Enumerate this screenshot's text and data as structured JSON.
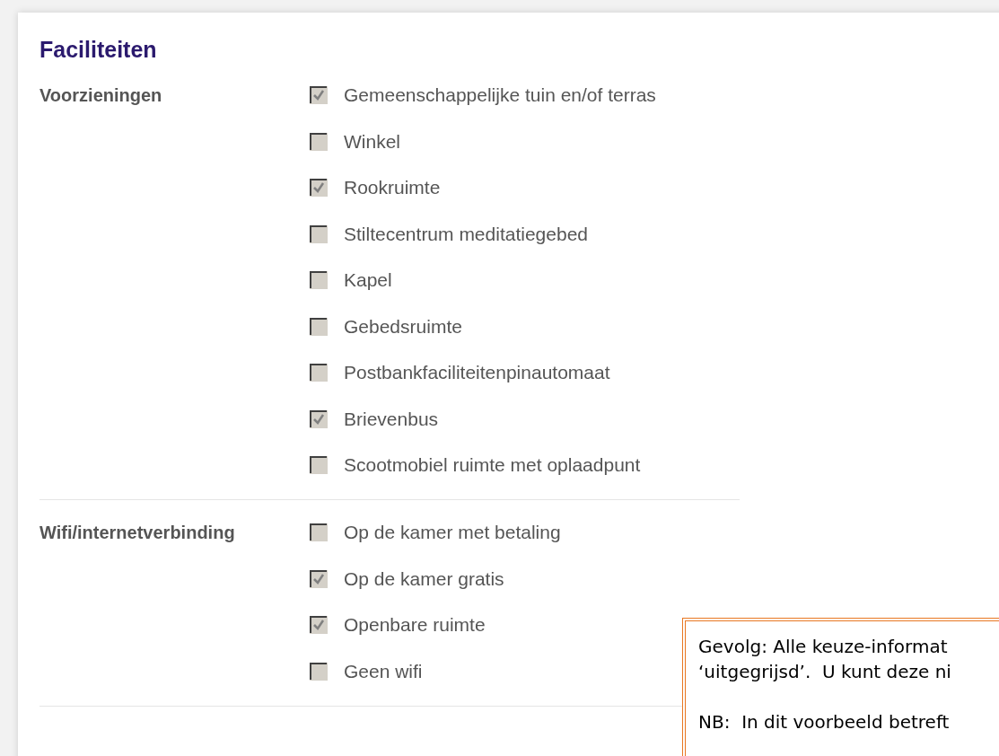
{
  "title": "Faciliteiten",
  "groups": [
    {
      "label": "Voorzieningen",
      "options": [
        {
          "label": "Gemeenschappelijke tuin en/of terras",
          "checked": true
        },
        {
          "label": "Winkel",
          "checked": false
        },
        {
          "label": "Rookruimte",
          "checked": true
        },
        {
          "label": "Stiltecentrum meditatiegebed",
          "checked": false
        },
        {
          "label": "Kapel",
          "checked": false
        },
        {
          "label": "Gebedsruimte",
          "checked": false
        },
        {
          "label": "Postbankfaciliteitenpinautomaat",
          "checked": false
        },
        {
          "label": "Brievenbus",
          "checked": true
        },
        {
          "label": "Scootmobiel ruimte met oplaadpunt",
          "checked": false
        }
      ]
    },
    {
      "label": "Wifi/internetverbinding",
      "options": [
        {
          "label": "Op de kamer met betaling",
          "checked": false
        },
        {
          "label": "Op de kamer gratis",
          "checked": true
        },
        {
          "label": "Openbare ruimte",
          "checked": true
        },
        {
          "label": "Geen wifi",
          "checked": false
        }
      ]
    }
  ],
  "note": {
    "lines": [
      "Gevolg: Alle keuze-informat",
      "‘uitgegrijsd’.  U kunt deze ni",
      "NB:  In dit voorbeeld betreft"
    ]
  }
}
